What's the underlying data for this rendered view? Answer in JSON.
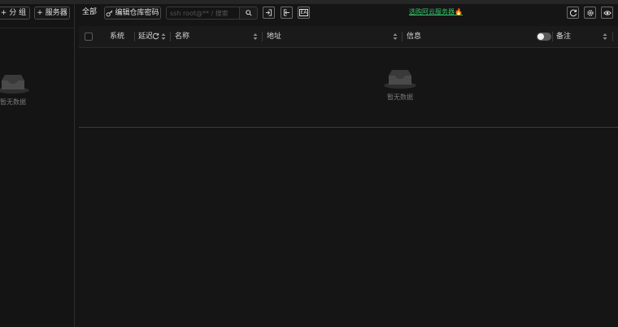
{
  "sidebar": {
    "add_group_label": "+ 分 组",
    "add_server_label": "+ 服务器",
    "empty_text": "暂无数据"
  },
  "toolbar": {
    "all_label": "全部",
    "edit_repo_password_label": "编辑仓库密码",
    "search_placeholder": "ssh root@** / 搜索",
    "promo_text": "选购阿云服务器🔥",
    "ea_label": "EA"
  },
  "table": {
    "columns": {
      "system": "系统",
      "latency": "延迟",
      "name": "名称",
      "address": "地址",
      "info": "信息",
      "remark": "备注"
    },
    "empty_text": "暂无数据"
  }
}
